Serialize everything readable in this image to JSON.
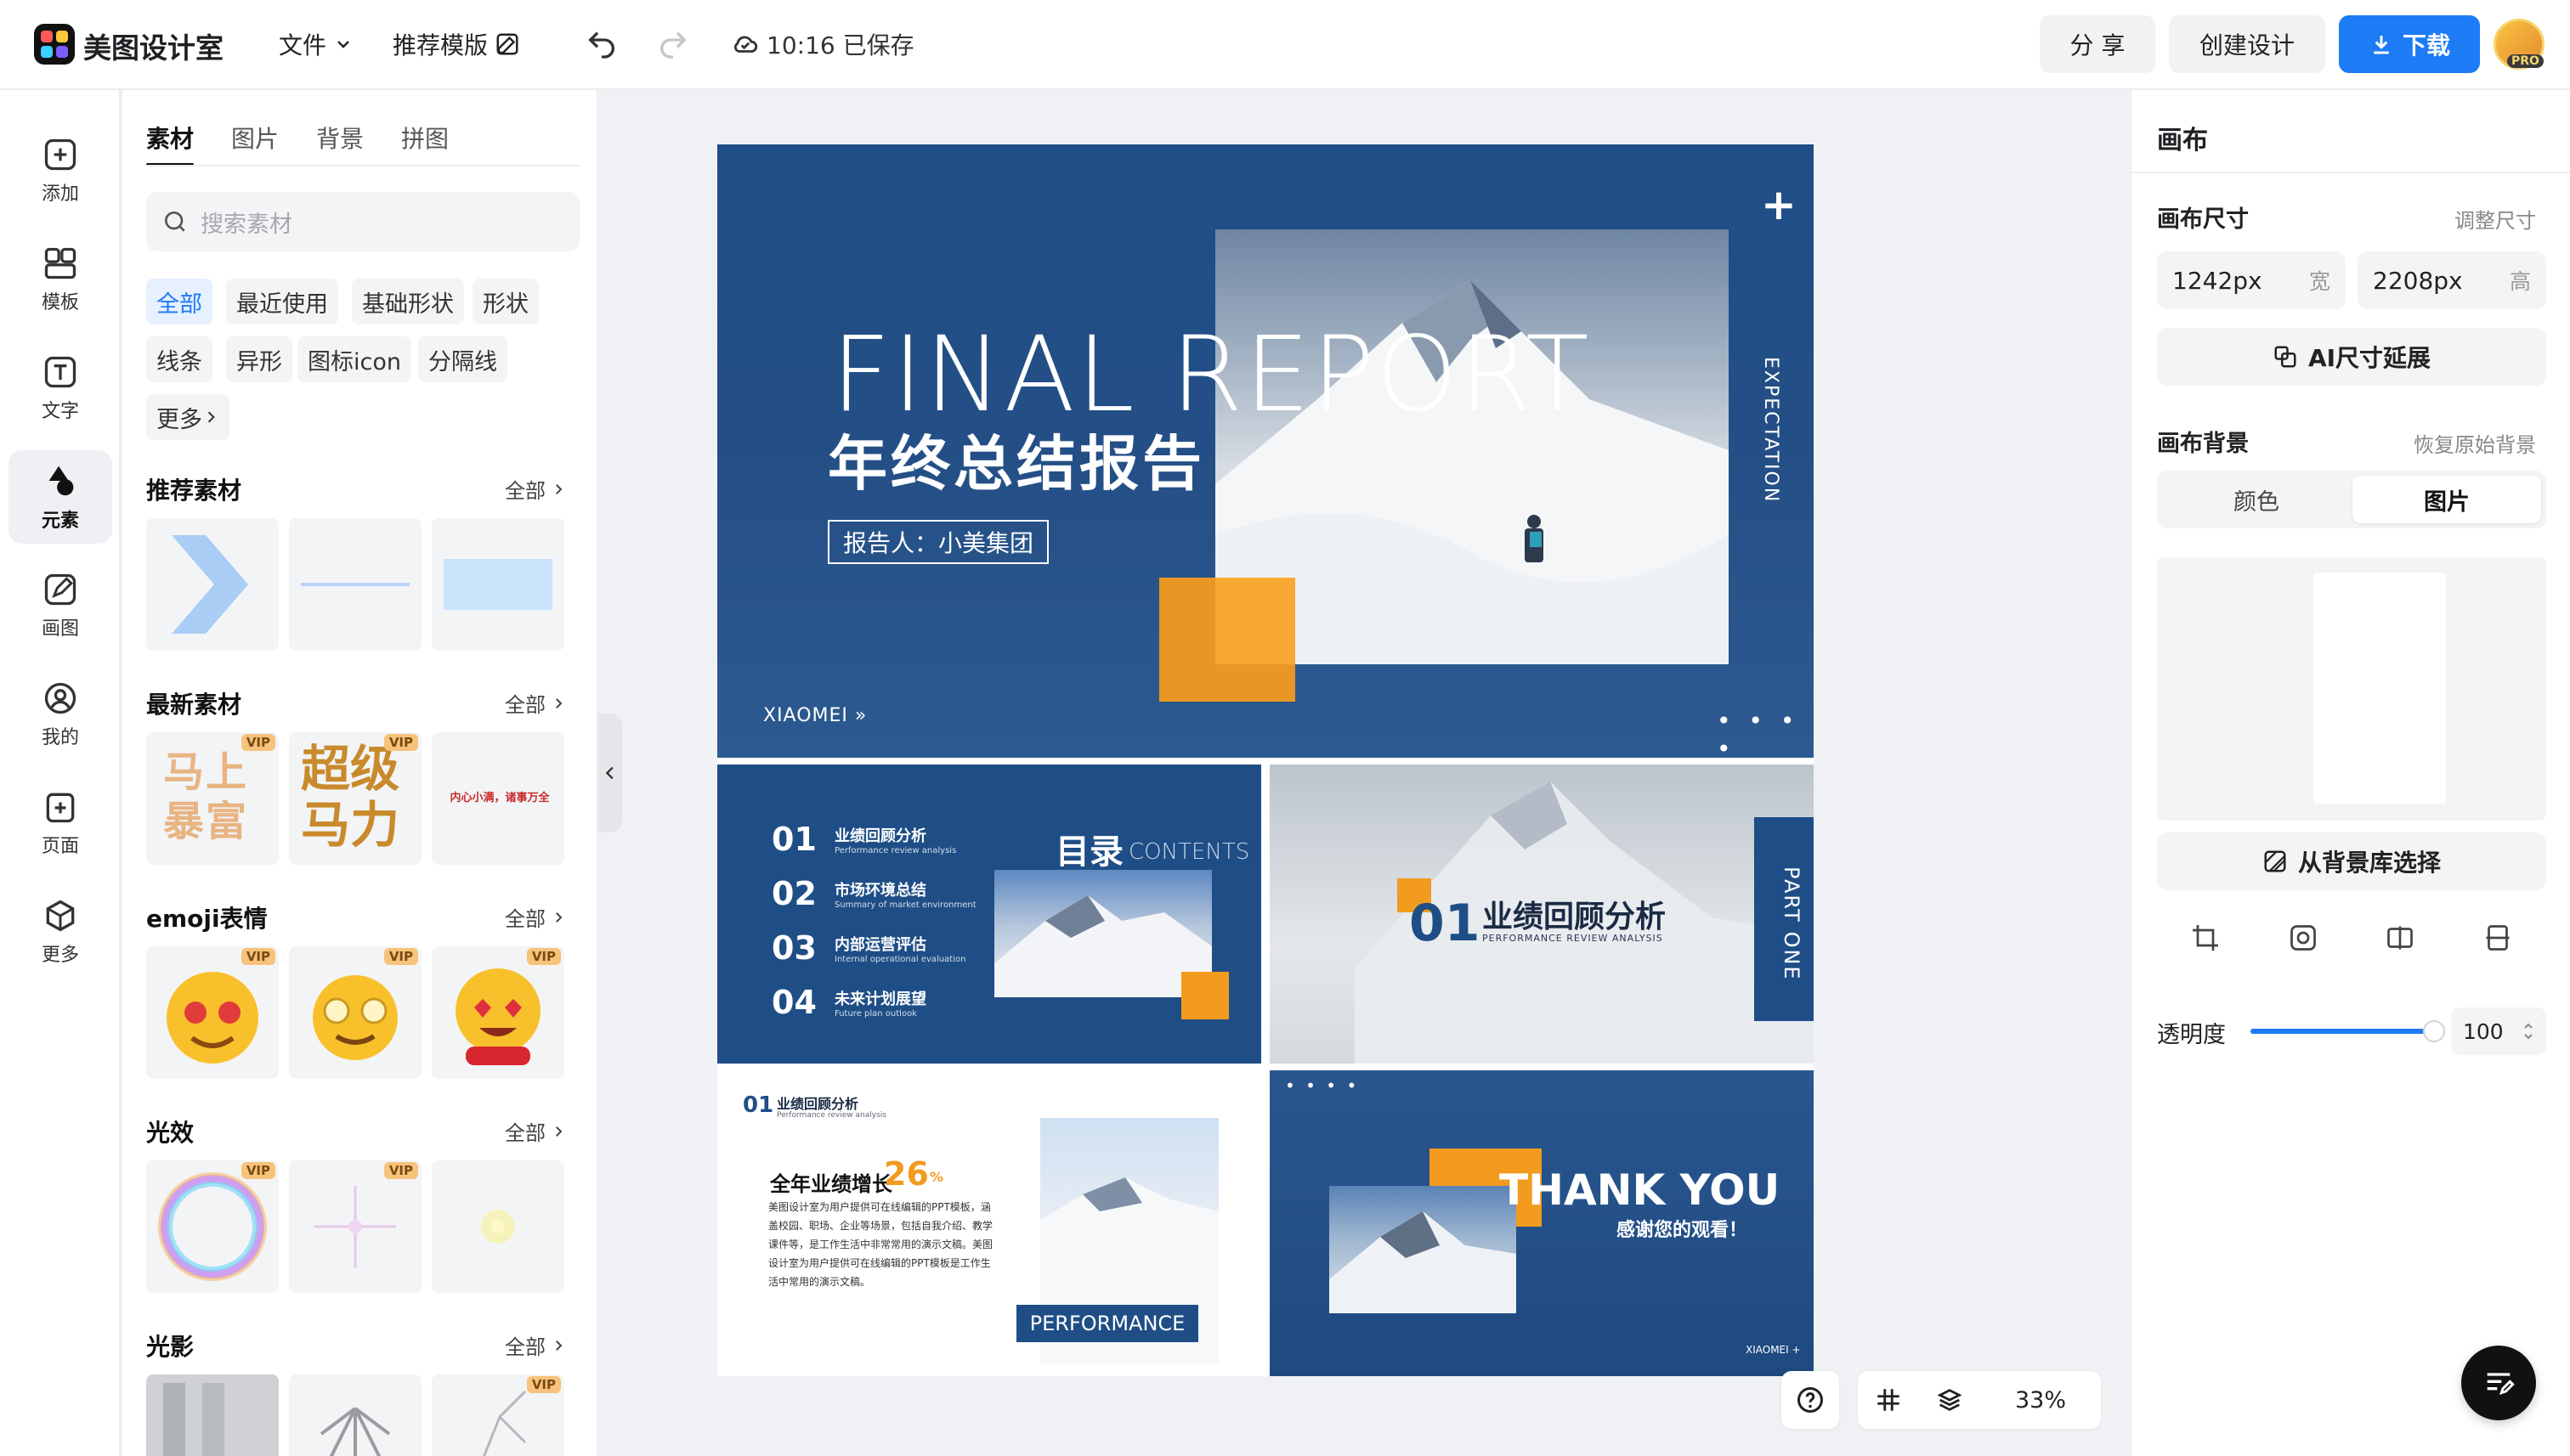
{
  "app": {
    "title": "美图设计室",
    "menu_file": "文件",
    "menu_template": "推荐模版",
    "save_status": "10:16 已保存",
    "share_label": "分 享",
    "create_label": "创建设计",
    "download_label": "下载",
    "pro_badge": "PRO",
    "accent": "#1d7bf5"
  },
  "rail": {
    "items": [
      {
        "label": "添加",
        "icon": "add-icon"
      },
      {
        "label": "模板",
        "icon": "template-icon"
      },
      {
        "label": "文字",
        "icon": "text-icon"
      },
      {
        "label": "元素",
        "icon": "element-icon"
      },
      {
        "label": "画图",
        "icon": "draw-icon"
      },
      {
        "label": "我的",
        "icon": "user-icon"
      },
      {
        "label": "页面",
        "icon": "page-icon"
      },
      {
        "label": "更多",
        "icon": "more-icon"
      }
    ],
    "active_index": 3
  },
  "panel": {
    "tabs": [
      "素材",
      "图片",
      "背景",
      "拼图"
    ],
    "active_tab": "素材",
    "search_placeholder": "搜索素材",
    "chips": [
      "全部",
      "最近使用",
      "基础形状",
      "形状",
      "线条",
      "异形",
      "图标icon",
      "分隔线",
      "更多"
    ],
    "all_label": "全部",
    "vip_label": "VIP",
    "sections": [
      {
        "title": "推荐素材"
      },
      {
        "title": "最新素材",
        "thumb_texts": [
          "马上暴富",
          "超级马力",
          "内心小满，诸事万全"
        ]
      },
      {
        "title": "emoji表情"
      },
      {
        "title": "光效"
      },
      {
        "title": "光影"
      }
    ]
  },
  "canvas": {
    "zoom": "33%",
    "slide1": {
      "en_title": "FINAL REPORT",
      "cn_title": "年终总结报告",
      "reporter": "报告人：小美集团",
      "brand": "XIAOMEI",
      "side_text": "EXPECTATION"
    },
    "slide2": {
      "heading_cn": "目录",
      "heading_en": "CONTENTS",
      "items": [
        {
          "num": "01",
          "cn": "业绩回顾分析",
          "en": "Performance review analysis"
        },
        {
          "num": "02",
          "cn": "市场环境总结",
          "en": "Summary of market environment"
        },
        {
          "num": "03",
          "cn": "内部运营评估",
          "en": "Internal operational evaluation"
        },
        {
          "num": "04",
          "cn": "未来计划展望",
          "en": "Future plan outlook"
        }
      ]
    },
    "slide3": {
      "num": "01",
      "cn": "业绩回顾分析",
      "en": "PERFORMANCE REVIEW ANALYSIS",
      "side_text": "PART ONE"
    },
    "slide4": {
      "num": "01",
      "cn": "业绩回顾分析",
      "en": "Performance review analysis",
      "growth_label": "全年业绩增长",
      "growth_value": "26",
      "growth_unit": "%",
      "body": "美图设计室为用户提供可在线编辑的PPT模板，涵盖校园、职场、企业等场景，包括自我介绍、教学课件等，是工作生活中非常常用的演示文稿。美图设计室为用户提供可在线编辑的PPT模板是工作生活中常用的演示文稿。",
      "tag": "PERFORMANCE"
    },
    "slide5": {
      "title": "THANK YOU",
      "subtitle": "感谢您的观看！",
      "brand": "XIAOMEI"
    }
  },
  "right": {
    "title": "画布",
    "size_label": "画布尺寸",
    "resize_link": "调整尺寸",
    "width_value": "1242px",
    "width_unit": "宽",
    "height_value": "2208px",
    "height_unit": "高",
    "ai_extend": "AI尺寸延展",
    "bg_label": "画布背景",
    "restore_link": "恢复原始背景",
    "seg_color": "颜色",
    "seg_image": "图片",
    "from_library": "从背景库选择",
    "opacity_label": "透明度",
    "opacity_value": "100",
    "opacity_level": 1.0
  }
}
